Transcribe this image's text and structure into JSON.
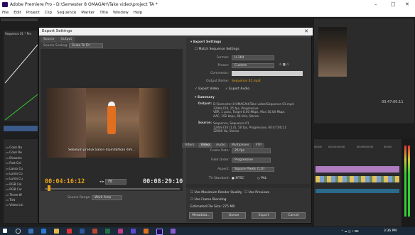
{
  "window": {
    "title": "Adobe Premiere Pro - D:\\Semester 8 OMAGAH\\Take video\\project TA *",
    "min": "–",
    "max": "□",
    "close": "✕"
  },
  "menu": [
    "File",
    "Edit",
    "Project",
    "Clip",
    "Sequence",
    "Marker",
    "Title",
    "Window",
    "Help"
  ],
  "bg_panels": {
    "left_panel_tab": "Sequence 01 * Pro",
    "timecode_right": "00:47:00:11",
    "media_list": [
      "Color Ba",
      "Color Re",
      "Dissolve",
      "Fast Col",
      "Lasso Cu",
      "Luma Co",
      "Luma Cu",
      "RGB Col",
      "RGB Cur",
      "Three-W",
      "Tint",
      "Video Lin"
    ],
    "timeline_ruler": [
      "00:00",
      "00:04:00:00",
      "00:09:00:00",
      "00:00"
    ],
    "meter_scale": [
      "0",
      "-6",
      "-12",
      "-18",
      "-24",
      "-30",
      "-36",
      "-42",
      "-48",
      "-54"
    ]
  },
  "dialog": {
    "title": "Export Settings",
    "left_tabs": [
      "Source",
      "Output"
    ],
    "source_scaling_label": "Source Scaling:",
    "source_scaling_value": "Scale To Fit",
    "subtitle_text": "Sebelum produk kalsin dipindahkan dim...",
    "timecode_in": "00:04:16:12",
    "timecode_out": "00:08:29:10",
    "fit_value": "Fit",
    "source_range_label": "Source Range:",
    "source_range_value": "Work Area",
    "export_settings_header": "Export Settings",
    "match_sequence": "Match Sequence Settings",
    "format_label": "Format:",
    "format_value": "H.264",
    "preset_label": "Preset:",
    "preset_value": "Custom",
    "comments_label": "Comments:",
    "output_name_label": "Output Name:",
    "output_name_value": "Sequence 01.mp4",
    "export_video": "Export Video",
    "export_audio": "Export Audio",
    "summary_header": "Summary",
    "output_label": "Output:",
    "output_lines": [
      "D:\\Semester 8 OMAGAH\\Take video\\Sequence 01.mp4",
      "1280x720, 25 fps, Progressive",
      "VBR, 1 pass, Target 8.00 Mbps, Max 16.00 Mbps",
      "AAC, 192 kbps, 48 kHz, Stereo"
    ],
    "source_label": "Source:",
    "source_lines": [
      "Sequence, Sequence 01",
      "1280x720 (1.0), 50 fps, Progressive, 00:47:00:11",
      "32000 Hz, Stereo"
    ],
    "right_tabs": [
      "Filters",
      "Video",
      "Audio",
      "Multiplexer",
      "FTP"
    ],
    "frame_rate_label": "Frame Rate:",
    "frame_rate_value": "25 fps",
    "field_order_label": "Field Order:",
    "field_order_value": "Progressive",
    "aspect_label": "Aspect:",
    "aspect_value": "Square Pixels (1.0)",
    "tv_standard_label": "TV Standard:",
    "ntsc": "NTSC",
    "pal": "PAL",
    "max_render": "Use Maximum Render Quality",
    "use_previews": "Use Previews",
    "frame_blending": "Use Frame Blending",
    "est_file_size": "Estimated File Size: 275 MB",
    "btn_metadata": "Metadata...",
    "btn_queue": "Queue",
    "btn_export": "Export",
    "btn_cancel": "Cancel"
  },
  "taskbar": {
    "time": "3:36 PM"
  },
  "colors": {
    "accent_orange": "#e8a21a",
    "link_blue": "#3b8edb",
    "dialog_bg": "#3b3b3b"
  }
}
